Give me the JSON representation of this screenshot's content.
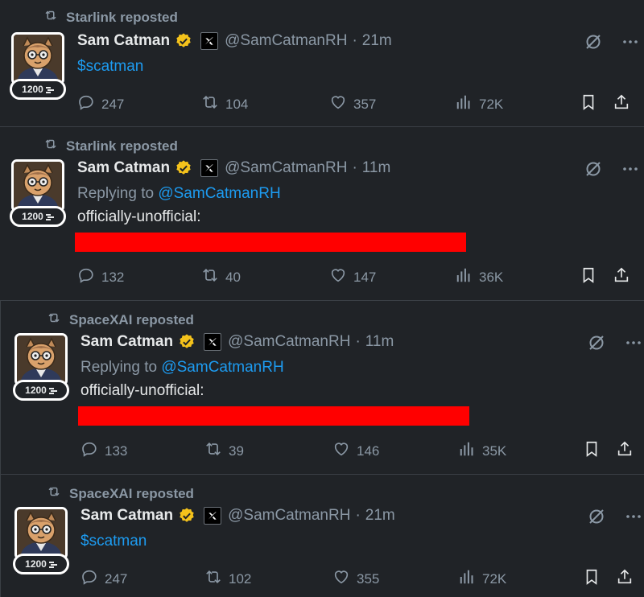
{
  "tweets": [
    {
      "reposter": "Starlink reposted",
      "name": "Sam Catman",
      "handle": "@SamCatmanRH",
      "dot": "·",
      "time": "21m",
      "badge_count": "1200",
      "replying_prefix": "",
      "replying_handle": "",
      "text": "$scatman",
      "text_is_link": true,
      "redacted": false,
      "stats": {
        "replies": "247",
        "reposts": "104",
        "likes": "357",
        "views": "72K"
      }
    },
    {
      "reposter": "Starlink reposted",
      "name": "Sam Catman",
      "handle": "@SamCatmanRH",
      "dot": "·",
      "time": "11m",
      "badge_count": "1200",
      "replying_prefix": "Replying to",
      "replying_handle": "@SamCatmanRH",
      "text": "officially-unofficial:",
      "text_is_link": false,
      "redacted": true,
      "stats": {
        "replies": "132",
        "reposts": "40",
        "likes": "147",
        "views": "36K"
      }
    },
    {
      "reposter": "SpaceXAI reposted",
      "name": "Sam Catman",
      "handle": "@SamCatmanRH",
      "dot": "·",
      "time": "11m",
      "badge_count": "1200",
      "replying_prefix": "Replying to",
      "replying_handle": "@SamCatmanRH",
      "text": "officially-unofficial:",
      "text_is_link": false,
      "redacted": true,
      "stats": {
        "replies": "133",
        "reposts": "39",
        "likes": "146",
        "views": "35K"
      }
    },
    {
      "reposter": "SpaceXAI reposted",
      "name": "Sam Catman",
      "handle": "@SamCatmanRH",
      "dot": "·",
      "time": "21m",
      "badge_count": "1200",
      "replying_prefix": "",
      "replying_handle": "",
      "text": "$scatman",
      "text_is_link": true,
      "redacted": false,
      "stats": {
        "replies": "247",
        "reposts": "102",
        "likes": "355",
        "views": "72K"
      }
    }
  ],
  "colors": {
    "background": "#202327",
    "text": "#e7e9ea",
    "muted": "#8b98a5",
    "link": "#1d9bf0",
    "verified": "#f4c21b",
    "redaction": "#ff0000"
  },
  "icons": [
    "repost-icon",
    "verified-icon",
    "x-logo-icon",
    "grok-icon",
    "more-icon",
    "reply-icon",
    "retweet-icon",
    "like-icon",
    "views-icon",
    "bookmark-icon",
    "share-icon"
  ]
}
